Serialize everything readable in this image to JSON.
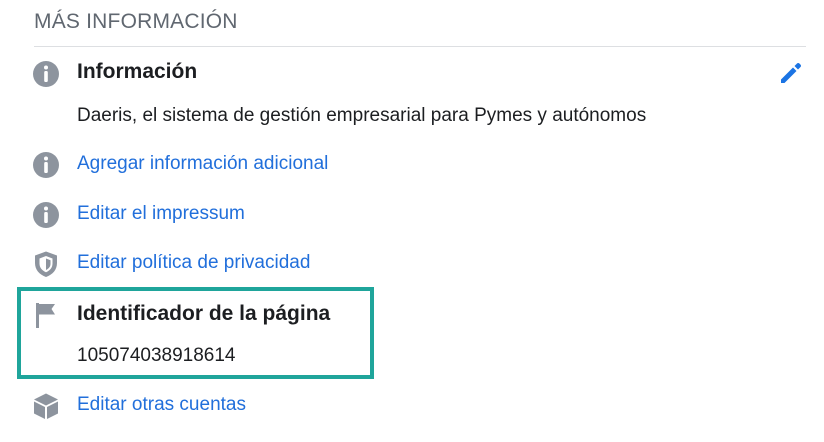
{
  "section": {
    "title": "MÁS INFORMACIÓN"
  },
  "info": {
    "heading": "Información",
    "description": "Daeris, el sistema de gestión empresarial para Pymes y autónomos",
    "edit_icon": "pencil-icon"
  },
  "links": {
    "add_info": "Agregar información adicional",
    "edit_impressum": "Editar el impressum",
    "edit_privacy": "Editar política de privacidad",
    "edit_other_accounts": "Editar otras cuentas"
  },
  "page_id": {
    "heading": "Identificador de la página",
    "value": "105074038918614"
  },
  "icons": {
    "info": "info-circle-icon",
    "shield": "shield-icon",
    "flag": "flag-icon",
    "cube": "cube-icon"
  },
  "colors": {
    "link": "#216fdb",
    "icon_gray": "#8d949e",
    "highlight_border": "#1fa59b",
    "edit_icon": "#1b74e4"
  }
}
